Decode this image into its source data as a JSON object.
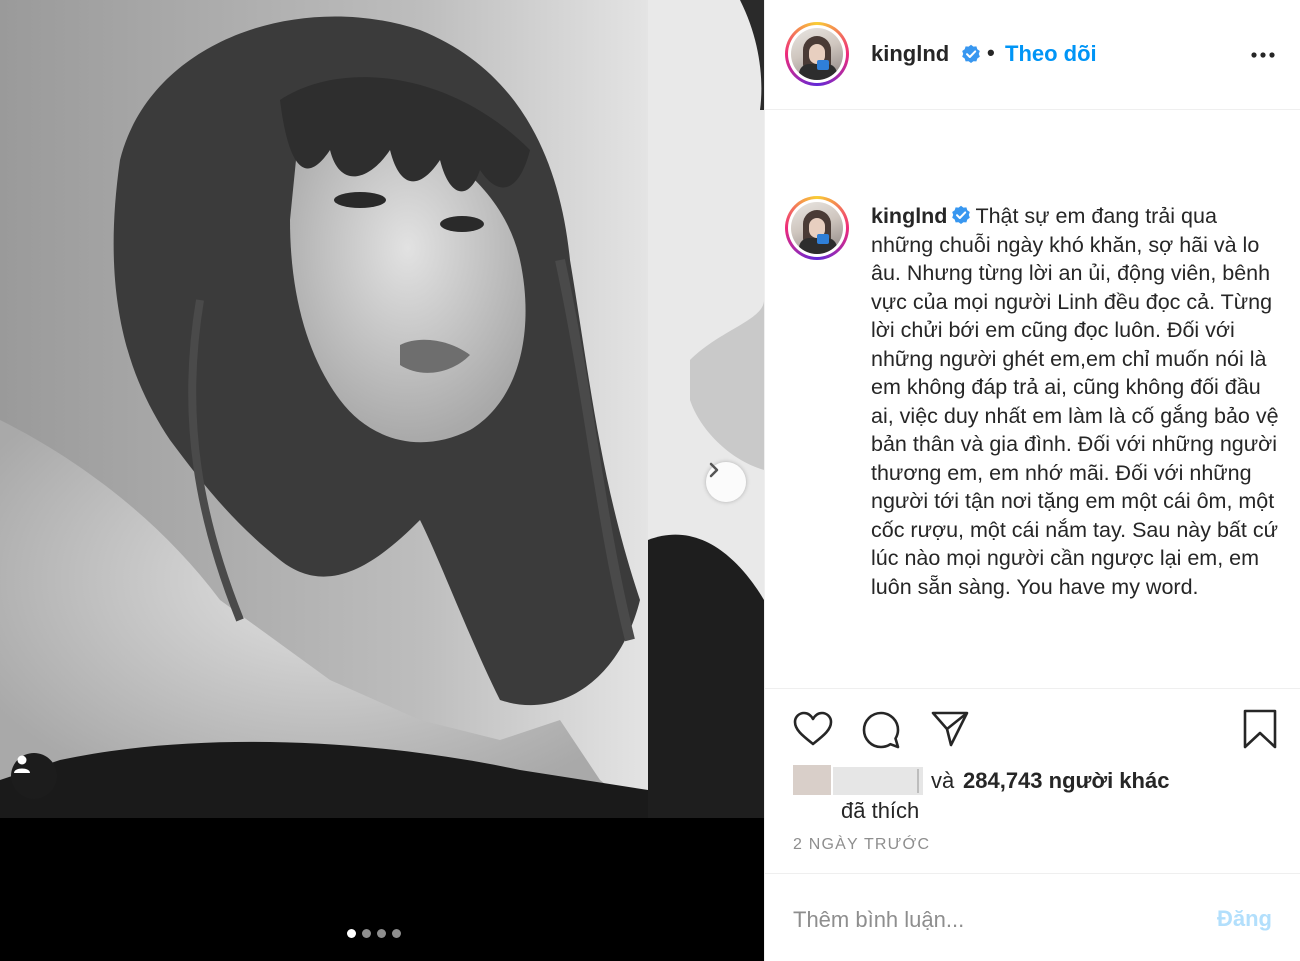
{
  "post": {
    "username": "kinglnd",
    "follow_label": "Theo dõi",
    "separator": "•",
    "caption": "Thật sự em đang trải qua những chuỗi ngày khó khăn, sợ hãi và lo âu. Nhưng từng lời an ủi, động viên, bênh vực của mọi người Linh đều đọc cả. Từng lời chửi bới em cũng đọc luôn. Đối với những người ghét em,em chỉ muốn nói là em không đáp trả ai, cũng không đối đầu ai, việc duy nhất em làm là cố gắng bảo vệ bản thân và gia đình. Đối với những người thương em, em nhớ mãi. Đối với những người tới tận nơi tặng em một cái ôm, một cốc rượu, một cái nắm tay. Sau này bất cứ lúc nào mọi người cần ngược lại em, em luôn sẵn sàng. You have my word.",
    "likes": {
      "and_label": "và",
      "count_label": "284,743 người khác",
      "suffix_label": "đã thích"
    },
    "timestamp": "2 NGÀY TRƯỚC",
    "comment": {
      "placeholder": "Thêm bình luận...",
      "post_label": "Đăng"
    }
  },
  "carousel": {
    "slide_count": 4,
    "active_index": 0
  },
  "colors": {
    "accent": "#0095f6",
    "verified": "#3897f0",
    "post_disabled": "#b2dffc",
    "muted": "#8e8e8e"
  },
  "icons": {
    "header": [
      "verified-badge-icon",
      "more-options-icon"
    ],
    "actions": [
      "heart-icon",
      "comment-icon",
      "share-icon",
      "bookmark-icon"
    ],
    "media": [
      "chevron-right-icon",
      "user-tag-icon"
    ]
  }
}
